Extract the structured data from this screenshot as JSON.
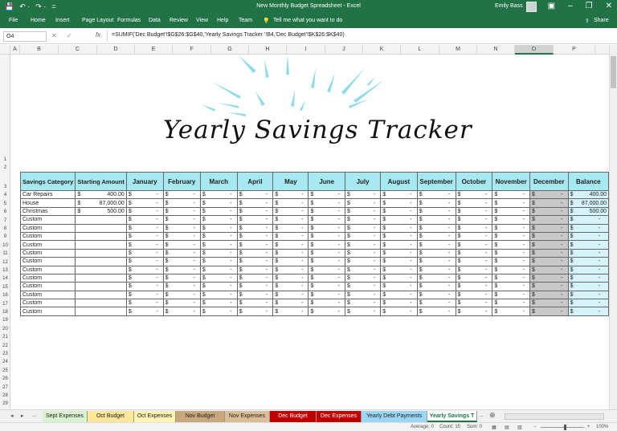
{
  "titlebar": {
    "title": "New Monthly Budget Spreadsheet  -  Excel",
    "user": "Emily Bass",
    "qat_save": "💾",
    "qat_undo": "↶ ·",
    "qat_redo": "↷ ·",
    "qat_more": "="
  },
  "ribbon": {
    "tabs": [
      "File",
      "Home",
      "Insert",
      "Page Layout",
      "Formulas",
      "Data",
      "Review",
      "View",
      "Help",
      "Team"
    ],
    "tell_me": "Tell me what you want to do",
    "share": "Share"
  },
  "formula_bar": {
    "name_box": "O4",
    "formula": "=SUMIF('Dec Budget'!$G$26:$G$40,'Yearly Savings Tracker '!B4,'Dec Budget'!$K$26:$K$40)"
  },
  "columns": [
    "A",
    "B",
    "C",
    "D",
    "E",
    "F",
    "G",
    "H",
    "I",
    "J",
    "K",
    "L",
    "M",
    "N",
    "O",
    "P"
  ],
  "rows": [
    "1",
    "2",
    "3",
    "4",
    "5",
    "6",
    "7",
    "8",
    "9",
    "10",
    "11",
    "12",
    "13",
    "14",
    "15",
    "16",
    "17",
    "18",
    "19",
    "20",
    "21",
    "22",
    "23",
    "24",
    "25",
    "26",
    "27",
    "28",
    "29"
  ],
  "title": "Yearly Savings Tracker",
  "table": {
    "headers": [
      "Savings Category",
      "Starting Amount",
      "January",
      "February",
      "March",
      "April",
      "May",
      "June",
      "July",
      "August",
      "September",
      "October",
      "November",
      "December",
      "Balance"
    ],
    "rows": [
      {
        "category": "Car Repairs",
        "start": "400.00",
        "balance": "400.00"
      },
      {
        "category": "House",
        "start": "87,000.00",
        "balance": "87,000.00"
      },
      {
        "category": "Christmas",
        "start": "500.00",
        "balance": "500.00"
      },
      {
        "category": "Custom",
        "start": "",
        "balance": "-"
      },
      {
        "category": "Custom",
        "start": "",
        "balance": "-"
      },
      {
        "category": "Custom",
        "start": "",
        "balance": "-"
      },
      {
        "category": "Custom",
        "start": "",
        "balance": "-"
      },
      {
        "category": "Custom",
        "start": "",
        "balance": "-"
      },
      {
        "category": "Custom",
        "start": "",
        "balance": "-"
      },
      {
        "category": "Custom",
        "start": "",
        "balance": "-"
      },
      {
        "category": "Custom",
        "start": "",
        "balance": "-"
      },
      {
        "category": "Custom",
        "start": "",
        "balance": "-"
      },
      {
        "category": "Custom",
        "start": "",
        "balance": "-"
      },
      {
        "category": "Custom",
        "start": "",
        "balance": "-"
      },
      {
        "category": "Custom",
        "start": "",
        "balance": "-"
      }
    ],
    "currency": "$",
    "dash": "-"
  },
  "sheet_tabs": [
    {
      "label": "Sept Expenses",
      "color": "#d9f2d0"
    },
    {
      "label": "Oct Budget",
      "color": "#ffe699"
    },
    {
      "label": "Oct Expenses",
      "color": "#fff2b3"
    },
    {
      "label": "Nov Budget",
      "color": "#c9a77c"
    },
    {
      "label": "Nov Expenses",
      "color": "#d9bd97"
    },
    {
      "label": "Dec Budget",
      "color": "#c00000"
    },
    {
      "label": "Dec Expenses",
      "color": "#c00000"
    },
    {
      "label": "Yearly Debt Payments",
      "color": "#9bd7f5"
    },
    {
      "label": "Yearly Savings T",
      "color": "#ffffff"
    }
  ],
  "tab_nav": {
    "prev": "◂",
    "next": "▸",
    "more": "...",
    "more_right": "...",
    "add": "⊕"
  },
  "status": {
    "average": "Average: 0",
    "count": "Count: 15",
    "sum": "Sum: 0",
    "zoom": "100%"
  },
  "colors": {
    "excel_green": "#217346",
    "header_teal": "#a7e9f2",
    "sparkle": "#8fdce8",
    "december_gray": "#c8c8c8"
  }
}
